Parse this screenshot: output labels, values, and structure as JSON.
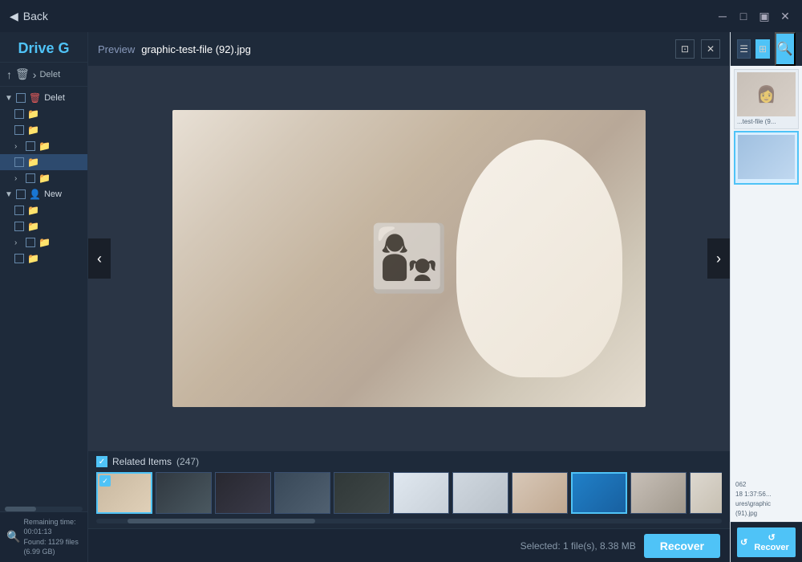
{
  "titleBar": {
    "backLabel": "Back",
    "windowControls": [
      "⊟",
      "⊡",
      "─",
      "✕"
    ]
  },
  "sidebar": {
    "driveLabel": "Drive G",
    "breadcrumb": "Delet",
    "treeItems": [
      {
        "id": "deleted-root",
        "label": "Delet",
        "type": "delete",
        "expandable": false,
        "indent": 0
      },
      {
        "id": "del-1",
        "label": "",
        "type": "folder",
        "expandable": false,
        "indent": 1
      },
      {
        "id": "del-2",
        "label": "",
        "type": "folder",
        "expandable": false,
        "indent": 1
      },
      {
        "id": "del-3",
        "label": "",
        "type": "folder",
        "expandable": true,
        "indent": 1
      },
      {
        "id": "del-4",
        "label": "",
        "type": "folder",
        "expandable": false,
        "indent": 1
      },
      {
        "id": "del-5",
        "label": "",
        "type": "folder",
        "expandable": true,
        "indent": 1
      },
      {
        "id": "new-root",
        "label": "New",
        "type": "new",
        "expandable": false,
        "indent": 0
      },
      {
        "id": "new-1",
        "label": "",
        "type": "folder",
        "expandable": false,
        "indent": 1
      },
      {
        "id": "new-2",
        "label": "",
        "type": "folder",
        "expandable": false,
        "indent": 1
      },
      {
        "id": "new-3",
        "label": "",
        "type": "folder",
        "expandable": true,
        "indent": 1
      },
      {
        "id": "new-4",
        "label": "",
        "type": "folder",
        "expandable": false,
        "indent": 1
      }
    ],
    "footer": {
      "remainingLabel": "Remaining time: 00:01:13",
      "foundLabel": "Found: 1129 files (6.99 GB)"
    }
  },
  "preview": {
    "titleLabel": "Preview",
    "filename": "graphic-test-file (92).jpg",
    "relatedItems": {
      "label": "Related Items",
      "count": "(247)"
    },
    "thumbnails": [
      {
        "id": 1,
        "selected": true,
        "checked": true
      },
      {
        "id": 2,
        "selected": false,
        "checked": false
      },
      {
        "id": 3,
        "selected": false,
        "checked": false
      },
      {
        "id": 4,
        "selected": false,
        "checked": false
      },
      {
        "id": 5,
        "selected": false,
        "checked": false
      },
      {
        "id": 6,
        "selected": false,
        "checked": false
      },
      {
        "id": 7,
        "selected": false,
        "checked": false
      },
      {
        "id": 8,
        "selected": false,
        "checked": false
      },
      {
        "id": 9,
        "selected": true,
        "checked": false
      },
      {
        "id": 10,
        "selected": false,
        "checked": false
      },
      {
        "id": 11,
        "selected": false,
        "checked": false
      }
    ]
  },
  "bottomBar": {
    "selectedInfo": "Selected: 1 file(s), 8.38 MB",
    "recoverLabel": "Recover"
  },
  "rightPanel": {
    "fileItems": [
      {
        "id": 1,
        "meta": "...test-file (9...",
        "type": "normal"
      },
      {
        "id": 2,
        "meta": "",
        "type": "blue"
      }
    ],
    "statusLines": [
      "062",
      "18 1:37:56...",
      "ures\\graphic",
      "(91).jpg"
    ],
    "recoverLabel": "↺  Recover"
  }
}
